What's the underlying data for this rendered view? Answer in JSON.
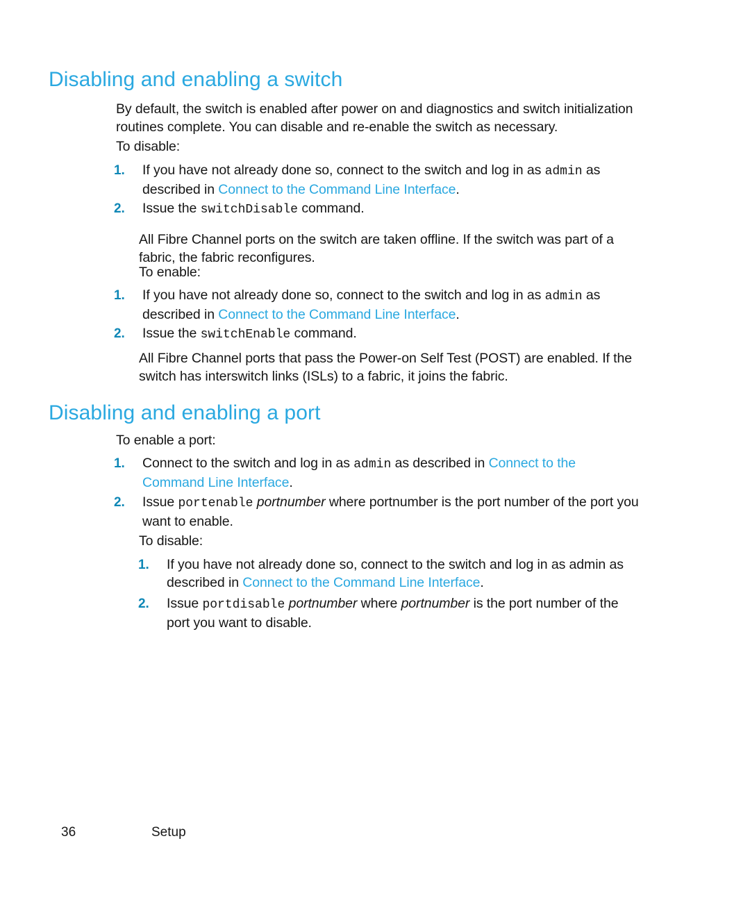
{
  "document": {
    "page_number": "36",
    "footer_label": "Setup",
    "colors": {
      "heading": "#2aa8e0",
      "link": "#2aa8e0",
      "list_marker": "#0e87b6",
      "body_text": "#161616",
      "page_background": "#ffffff"
    }
  },
  "sections": [
    {
      "heading": "Disabling and enabling a switch",
      "intro_paragraph": "By default, the switch is enabled after power on and diagnostics and switch initialization routines complete.  You can disable and re-enable the switch as necessary.",
      "lead_in_disable": "To disable:",
      "disable_steps": [
        {
          "marker": "1.",
          "text_before_code": "If you have not already done so, connect to the switch and log in as ",
          "code": "admin",
          "text_after_code": " as described in ",
          "link": "Connect to the Command Line Interface",
          "text_end": "."
        },
        {
          "marker": "2.",
          "text_before_code": "Issue the ",
          "code": "switchDisable",
          "text_after_code": " command.",
          "link": "",
          "text_end": ""
        }
      ],
      "disable_result": "All Fibre Channel ports on the switch are taken offline.  If the switch was part of a fabric, the fabric reconfigures.",
      "lead_in_enable": "To enable:",
      "enable_steps": [
        {
          "marker": "1.",
          "text_before_code": "If you have not already done so, connect to the switch and log in as ",
          "code": "admin",
          "text_after_code": " as described in ",
          "link": "Connect to the Command Line Interface",
          "text_end": "."
        },
        {
          "marker": "2.",
          "text_before_code": "Issue the ",
          "code": "switchEnable",
          "text_after_code": " command.",
          "link": "",
          "text_end": ""
        }
      ],
      "enable_result": "All Fibre Channel ports that pass the Power-on Self Test (POST) are enabled.  If the switch has interswitch links (ISLs) to a fabric, it joins the fabric."
    },
    {
      "heading": "Disabling and enabling a port",
      "lead_in_enable": "To enable a port:",
      "enable_steps": [
        {
          "marker": "1.",
          "text_before_code": "Connect to the switch and log in as ",
          "code": "admin",
          "text_after_code": " as described in ",
          "link": "Connect to the Command Line Interface",
          "text_end": "."
        },
        {
          "marker": "2.",
          "text_before_code": "Issue ",
          "code": "portenable",
          "italic": "portnumber",
          "text_after_code": " where portnumber is the port number of the port you want to enable.",
          "link": "",
          "text_end": ""
        }
      ],
      "lead_in_disable": "To disable:",
      "disable_steps": [
        {
          "marker": "1.",
          "text_before_code": "If you have not already done so, connect to the switch and log in as admin as described in ",
          "code": "",
          "text_after_code": "",
          "link": "Connect to the Command Line Interface",
          "text_end": "."
        },
        {
          "marker": "2.",
          "text_before_code": "Issue ",
          "code": "portdisable",
          "italic": "portnumber",
          "text_mid": " where ",
          "italic2": "portnumber",
          "text_after_code": " is the port number of the port you want to disable.",
          "link": "",
          "text_end": ""
        }
      ]
    }
  ]
}
